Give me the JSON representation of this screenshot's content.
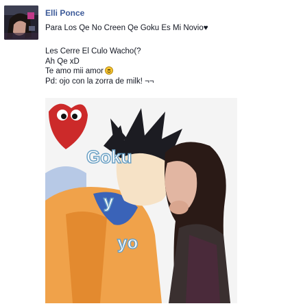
{
  "post": {
    "author": "Elli Ponce",
    "status": "Para Los Qe No Creen Qe Goku Es Mi Novio♥",
    "body_lines": [
      "Les Cerre El Culo Wacho(?",
      "Ah Qe xD",
      "Te amo mii amor",
      "Pd: ojo con la zorra de milk! ¬¬"
    ],
    "photo_caption": [
      "Goku",
      "y",
      "yo"
    ]
  },
  "colors": {
    "link": "#3b5998",
    "text": "#141823"
  },
  "icons": {
    "smile": "smiley-emoji-icon"
  }
}
